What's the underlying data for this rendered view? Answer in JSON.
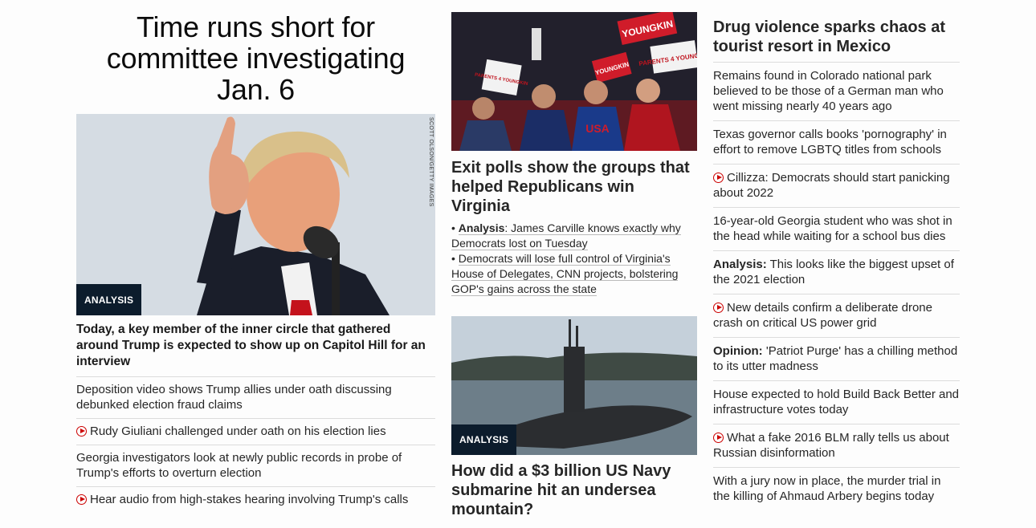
{
  "left": {
    "headline": "Time runs short for committee investigating Jan. 6",
    "image_credit": "SCOTT OLSON/GETTY IMAGES",
    "badge": "ANALYSIS",
    "lead_text": "Today, a key member of the inner circle that gathered around Trump is expected to show up on Capitol Hill for an interview",
    "links": [
      {
        "text": "Deposition video shows Trump allies under oath discussing debunked election fraud claims",
        "video": false
      },
      {
        "text": "Rudy Giuliani challenged under oath on his election lies",
        "video": true
      },
      {
        "text": "Georgia investigators look at newly public records in probe of Trump's efforts to overturn election",
        "video": false
      },
      {
        "text": "Hear audio from high-stakes hearing involving Trump's calls",
        "video": true
      }
    ]
  },
  "middle": {
    "story1": {
      "title": "Exit polls show the groups that helped Republicans win Virginia",
      "bullet1_label": "Analysis",
      "bullet1_text": ": James Carville knows exactly why Democrats lost on Tuesday",
      "bullet2_text": "Democrats will lose full control of Virginia's House of Delegates, CNN projects, bolstering GOP's gains across the state",
      "sign_texts": [
        "YOUNGKIN",
        "PARENTS 4 YOUNGKIN",
        "PARENTS 4 YOUNGKIN",
        "YOUNGKIN",
        "USA"
      ]
    },
    "story2": {
      "badge": "ANALYSIS",
      "title": "How did a $3 billion US Navy submarine hit an undersea mountain?"
    }
  },
  "right": {
    "headline": "Drug violence sparks chaos at tourist resort in Mexico",
    "links": [
      {
        "label": "",
        "text": "Remains found in Colorado national park believed to be those of a German man who went missing nearly 40 years ago",
        "video": false
      },
      {
        "label": "",
        "text": "Texas governor calls books 'pornography' in effort to remove LGBTQ titles from schools",
        "video": false
      },
      {
        "label": "",
        "text": "Cillizza: Democrats should start panicking about 2022",
        "video": true
      },
      {
        "label": "",
        "text": "16-year-old Georgia student who was shot in the head while waiting for a school bus dies",
        "video": false
      },
      {
        "label": "Analysis:",
        "text": " This looks like the biggest upset of the 2021 election",
        "video": false
      },
      {
        "label": "",
        "text": "New details confirm a deliberate drone crash on critical US power grid",
        "video": true
      },
      {
        "label": "Opinion:",
        "text": " 'Patriot Purge' has a chilling method to its utter madness",
        "video": false
      },
      {
        "label": "",
        "text": "House expected to hold Build Back Better and infrastructure votes today",
        "video": false
      },
      {
        "label": "",
        "text": "What a fake 2016 BLM rally tells us about Russian disinformation",
        "video": true
      },
      {
        "label": "",
        "text": "With a jury now in place, the murder trial in the killing of Ahmaud Arbery begins today",
        "video": false
      }
    ]
  },
  "colors": {
    "badge_bg": "#0c1c2c",
    "video_icon": "#cc0000",
    "divider": "#dcdcdc"
  }
}
